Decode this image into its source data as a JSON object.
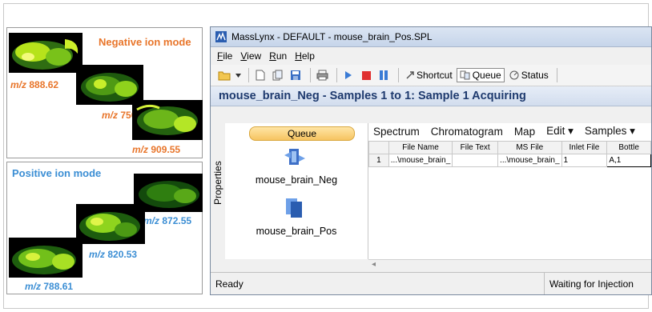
{
  "negative": {
    "title": "Negative ion mode",
    "mz_prefix": "m/z",
    "images": [
      "888.62",
      "750.54",
      "909.55"
    ]
  },
  "positive": {
    "title": "Positive ion mode",
    "mz_prefix": "m/z",
    "images": [
      "872.55",
      "820.53",
      "788.61"
    ]
  },
  "app": {
    "title": "MassLynx - DEFAULT - mouse_brain_Pos.SPL",
    "menu": [
      "File",
      "View",
      "Run",
      "Help"
    ],
    "toolbar": {
      "shortcut": "Shortcut",
      "queue": "Queue",
      "status": "Status"
    },
    "headline": "mouse_brain_Neg - Samples 1 to 1: Sample 1 Acquiring",
    "properties_label": "Properties",
    "queue_label": "Queue",
    "nav_items": [
      "mouse_brain_Neg",
      "mouse_brain_Pos"
    ],
    "view_menu": [
      "Spectrum",
      "Chromatogram",
      "Map",
      "Edit ▾",
      "Samples ▾"
    ],
    "grid": {
      "columns": [
        "File Name",
        "File Text",
        "MS File",
        "Inlet File",
        "Bottle"
      ],
      "rows": [
        {
          "index": "1",
          "file_name": "...\\mouse_brain_",
          "file_text": "",
          "ms_file": "...\\mouse_brain_",
          "inlet_file": "1",
          "bottle": "A,1"
        }
      ]
    },
    "status_left": "Ready",
    "status_right": "Waiting for Injection"
  }
}
